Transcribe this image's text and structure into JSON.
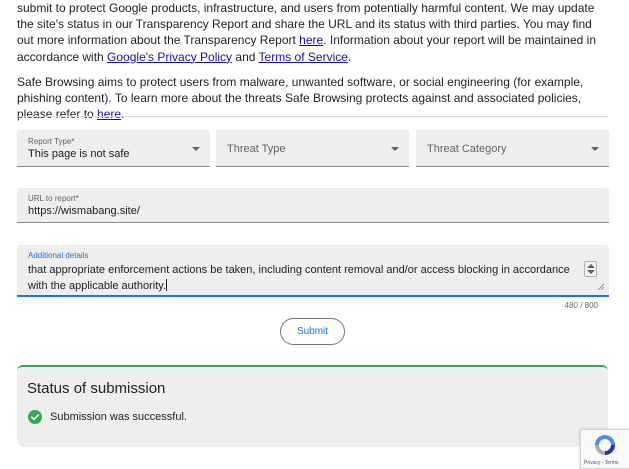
{
  "intro": {
    "para1_part1": "submit to protect Google products, infrastructure, and users from potentially harmful content. We may update the site's status in our Transparency Report and share the URL and its status with third parties. You may find out more information about the Transparency Report ",
    "link_here_1": "here",
    "para1_part2": ". Information about your report will be maintained in accordance with ",
    "link_privacy": "Google's Privacy Policy",
    "para1_and": " and ",
    "link_terms": "Terms of Service",
    "para1_end": ".",
    "para2_text": "Safe Browsing aims to protect users from malware, unwanted software, or social engineering (for example, phishing content). To learn more about the threats Safe Browsing protects against and associated policies, please refer to ",
    "link_here_2": "here",
    "para2_end": "."
  },
  "form": {
    "report_type": {
      "label": "Report Type*",
      "value": "This page is not safe"
    },
    "threat_type": {
      "placeholder": "Threat Type"
    },
    "threat_category": {
      "placeholder": "Threat Category"
    },
    "url": {
      "label": "URL to report*",
      "value": "https://wismabang.site/"
    },
    "details": {
      "label": "Additional details",
      "value": "that appropriate enforcement actions be taken, including content removal and/or access blocking in accordance with the applicable authority."
    },
    "char_count": "480 / 800",
    "submit_label": "Submit"
  },
  "status": {
    "title": "Status of submission",
    "message": "Submission was successful.",
    "success_color": "#34a853"
  },
  "recaptcha": {
    "links": "Privacy - Terms"
  }
}
